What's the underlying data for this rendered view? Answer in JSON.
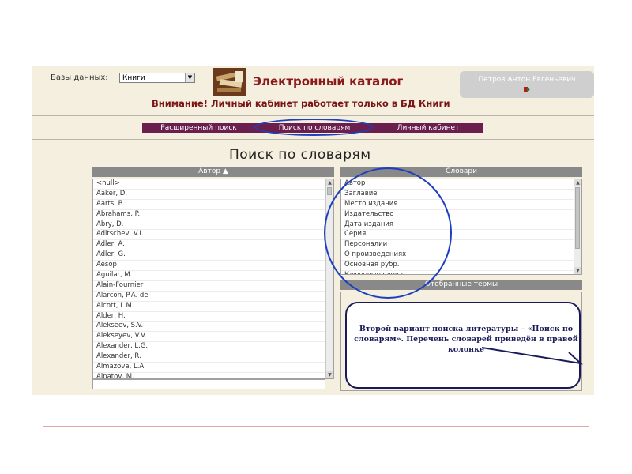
{
  "header": {
    "db_label": "Базы данных:",
    "db_selected": "Книги",
    "app_title": "Электронный каталог",
    "user_name": "Петров Антон Евгеньевич",
    "warning": "Внимание! Личный кабинет работает только в БД Книги"
  },
  "nav": {
    "advanced": "Расширенный поиск",
    "dictionaries": "Поиск по словарям",
    "cabinet": "Личный кабинет"
  },
  "page_title": "Поиск по словарям",
  "authors": {
    "header": "Автор ▲",
    "items": [
      "<null>",
      "Aaker, D.",
      "Aarts, B.",
      "Abrahams, P.",
      "Abry, D.",
      "Aditschev, V.I.",
      "Adler, A.",
      "Adler, G.",
      "Aesop",
      "Aguilar, M.",
      "Alain-Fournier",
      "Alarcon, P.A. de",
      "Alcott, L.M.",
      "Alder, H.",
      "Alekseev, S.V.",
      "Alekseyev, V.V.",
      "Alexander, L.G.",
      "Alexander, R.",
      "Almazova, L.A.",
      "Alpatov, M."
    ]
  },
  "dictionaries": {
    "header": "Словари",
    "items": [
      "Автор",
      "Заглавие",
      "Место издания",
      "Издательство",
      "Дата издания",
      "Серия",
      "Персоналии",
      "О произведениях",
      "Основная рубр.",
      "Ключевые слова"
    ]
  },
  "selected_terms": {
    "header": "Отобранные термы"
  },
  "callout": {
    "text": "Второй вариант поиска литературы – «Поиск по словарям». Перечень словарей приведён в правой колонке"
  },
  "colors": {
    "nav_bg": "#6a1f4f",
    "title_red": "#8b1a1a",
    "annotation_blue": "#1d3fbf"
  }
}
